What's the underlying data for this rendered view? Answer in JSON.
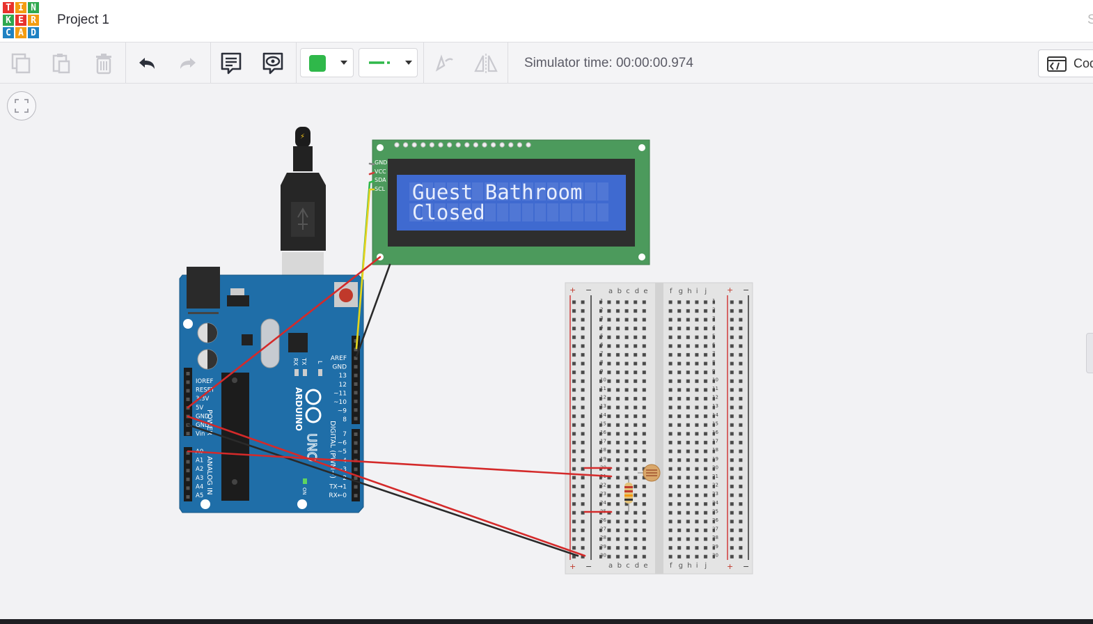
{
  "app": {
    "logo_letters": [
      "T",
      "I",
      "N",
      "K",
      "E",
      "R",
      "C",
      "A",
      "D"
    ],
    "logo_colors": [
      "#e8322d",
      "#f39c12",
      "#2fa84f",
      "#2fa84f",
      "#e8322d",
      "#f39c12",
      "#1f82c3",
      "#f39c12",
      "#1f82c3"
    ],
    "project_title": "Project 1",
    "edge_letter": "S"
  },
  "toolbar": {
    "buttons": [
      {
        "name": "copy-icon"
      },
      {
        "name": "paste-icon"
      },
      {
        "name": "delete-icon"
      },
      {
        "name": "undo-icon"
      },
      {
        "name": "redo-icon"
      },
      {
        "name": "notes-icon"
      },
      {
        "name": "view-notes-icon"
      }
    ],
    "color_value": "#2fb84a",
    "wire_color": "#2fb84a",
    "simulator_time": "Simulator time: 00:00:00.974",
    "code_label": "Code"
  },
  "circuit": {
    "lcd": {
      "line1": "Guest Bathroom",
      "line2": "Closed",
      "pins": [
        "GND",
        "VCC",
        "SDA",
        "SCL"
      ],
      "board_color": "#4c9a5c",
      "screen_color": "#3f6ad0"
    },
    "arduino": {
      "brand": "ARDUINO",
      "model": "UNO",
      "power_label": "POWER",
      "analog_label": "ANALOG IN",
      "digital_label": "DIGITAL (PWM~)",
      "on_label": "ON",
      "rx_label": "RX",
      "tx_label": "TX",
      "l_label": "L",
      "power_pins": [
        "IOREF",
        "RESET",
        "3.3V",
        "5V",
        "GND",
        "GND",
        "Vin"
      ],
      "analog_pins": [
        "A0",
        "A1",
        "A2",
        "A3",
        "A4",
        "A5"
      ],
      "digital_top": [
        "AREF",
        "GND",
        "13",
        "12",
        "~11",
        "~10",
        "~9",
        "8"
      ],
      "digital_bottom": [
        "7",
        "~6",
        "~5",
        "4",
        "~3",
        "2",
        "TX→1",
        "RX←0"
      ]
    },
    "breadboard": {
      "cols_left": [
        "a",
        "b",
        "c",
        "d",
        "e"
      ],
      "cols_right": [
        "f",
        "g",
        "h",
        "i",
        "j"
      ],
      "plus": "+",
      "minus": "−"
    }
  }
}
